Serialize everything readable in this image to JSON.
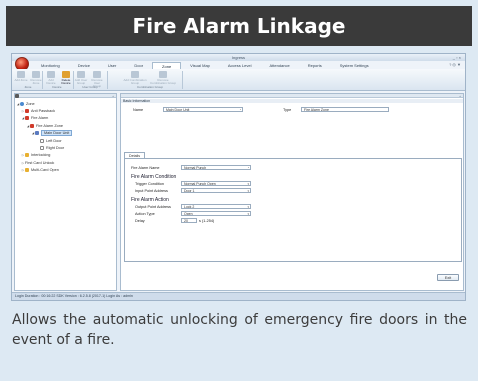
{
  "heading": "Fire Alarm Linkage",
  "caption": "Allows the automatic unlocking of emergency fire doors in the event of a fire.",
  "app": {
    "window_title": "Ingress",
    "window_buttons": "_ ▫ ×",
    "menu": [
      "Monitoring",
      "Device",
      "User",
      "Door",
      "Zone",
      "Visual Map",
      "Access Level",
      "Attendance",
      "Reports",
      "System Settings"
    ],
    "active_menu": "Zone",
    "help_icons": "? ◎ ▼",
    "ribbon": {
      "buttons": [
        {
          "label": "Add Zone",
          "enabled": false
        },
        {
          "label": "Remove Zone",
          "enabled": false
        },
        {
          "label": "Add Device",
          "enabled": false
        },
        {
          "label": "Delete Device",
          "enabled": true
        },
        {
          "label": "Add User Group",
          "enabled": false
        },
        {
          "label": "Remove User Group",
          "enabled": false
        },
        {
          "label": "Add Combination Group",
          "enabled": false
        },
        {
          "label": "Remove Combination Group",
          "enabled": false
        }
      ],
      "groups": [
        "Zone",
        "Device",
        "User Group",
        "Combination Group"
      ]
    },
    "tree": [
      {
        "label": "Zone",
        "level": 0,
        "icon": "zone"
      },
      {
        "label": "Anti Passback",
        "level": 1,
        "icon": "red"
      },
      {
        "label": "Fire Alarm",
        "level": 1,
        "icon": "red"
      },
      {
        "label": "Fire Alarm Zone",
        "level": 2,
        "icon": "red"
      },
      {
        "label": "Main Door Unit",
        "level": 3,
        "icon": "door",
        "selected": true
      },
      {
        "label": "Left Door",
        "level": 4,
        "icon": "doc"
      },
      {
        "label": "Right Door",
        "level": 4,
        "icon": "doc"
      },
      {
        "label": "Interlocking",
        "level": 1,
        "icon": "lock"
      },
      {
        "label": "First Card Unlock",
        "level": 1,
        "icon": "card"
      },
      {
        "label": "Multi-Card Open",
        "level": 1,
        "icon": "lock"
      }
    ],
    "basic_info": {
      "section_label": "Basic Information",
      "name_label": "Name",
      "name_value": "Main Door Unit",
      "type_label": "Type",
      "type_value": "Fire Alarm Zone"
    },
    "details_tab": "Details",
    "details": {
      "fire_alarm_name_label": "Fire Alarm Name",
      "fire_alarm_name_value": "Normal Punch",
      "condition_heading": "Fire Alarm Condition",
      "trigger_label": "Trigger Condition",
      "trigger_value": "Normal Punch Open",
      "input_label": "Input Point Address",
      "input_value": "Door 1",
      "action_heading": "Fire Alarm Action",
      "output_label": "Output Point Address",
      "output_value": "Lock 2",
      "action_type_label": "Action Type",
      "action_type_value": "Open",
      "delay_label": "Delay",
      "delay_value": "20",
      "delay_unit": "s (1-254)"
    },
    "exit_button": "Exit",
    "status_bar": "Login Duration : 00:16:22   SDK Version : 6.2.5.8 (2017-1)   Login As : admin"
  }
}
